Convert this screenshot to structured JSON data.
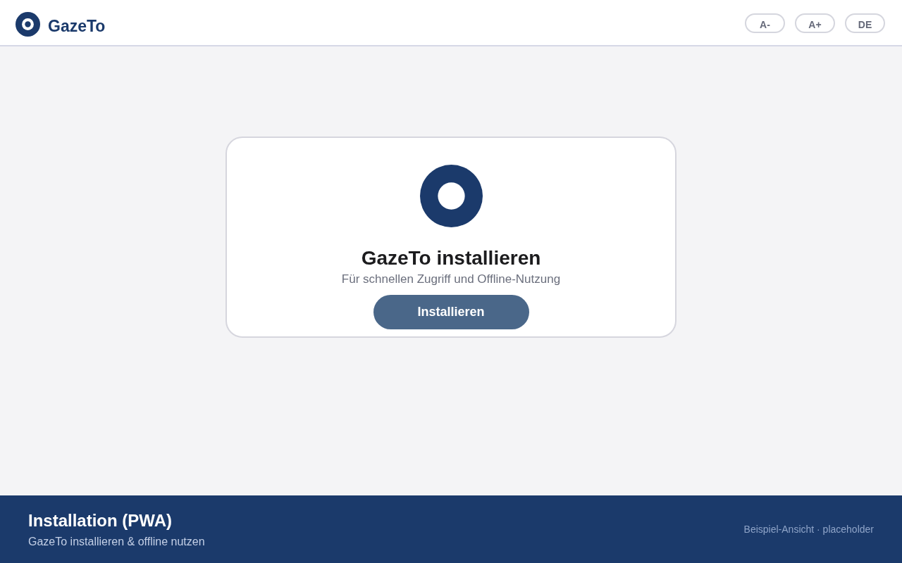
{
  "header": {
    "brand": "GazeTo",
    "buttons": [
      "A-",
      "A+",
      "DE"
    ]
  },
  "install_card": {
    "title": "GazeTo installieren",
    "subtitle": "Für schnellen Zugriff und Offline-Nutzung",
    "button": "Installieren"
  },
  "footer": {
    "title": "Installation (PWA)",
    "subtitle": "GazeTo installieren & offline nutzen",
    "note": "Beispiel-Ansicht · placeholder"
  }
}
